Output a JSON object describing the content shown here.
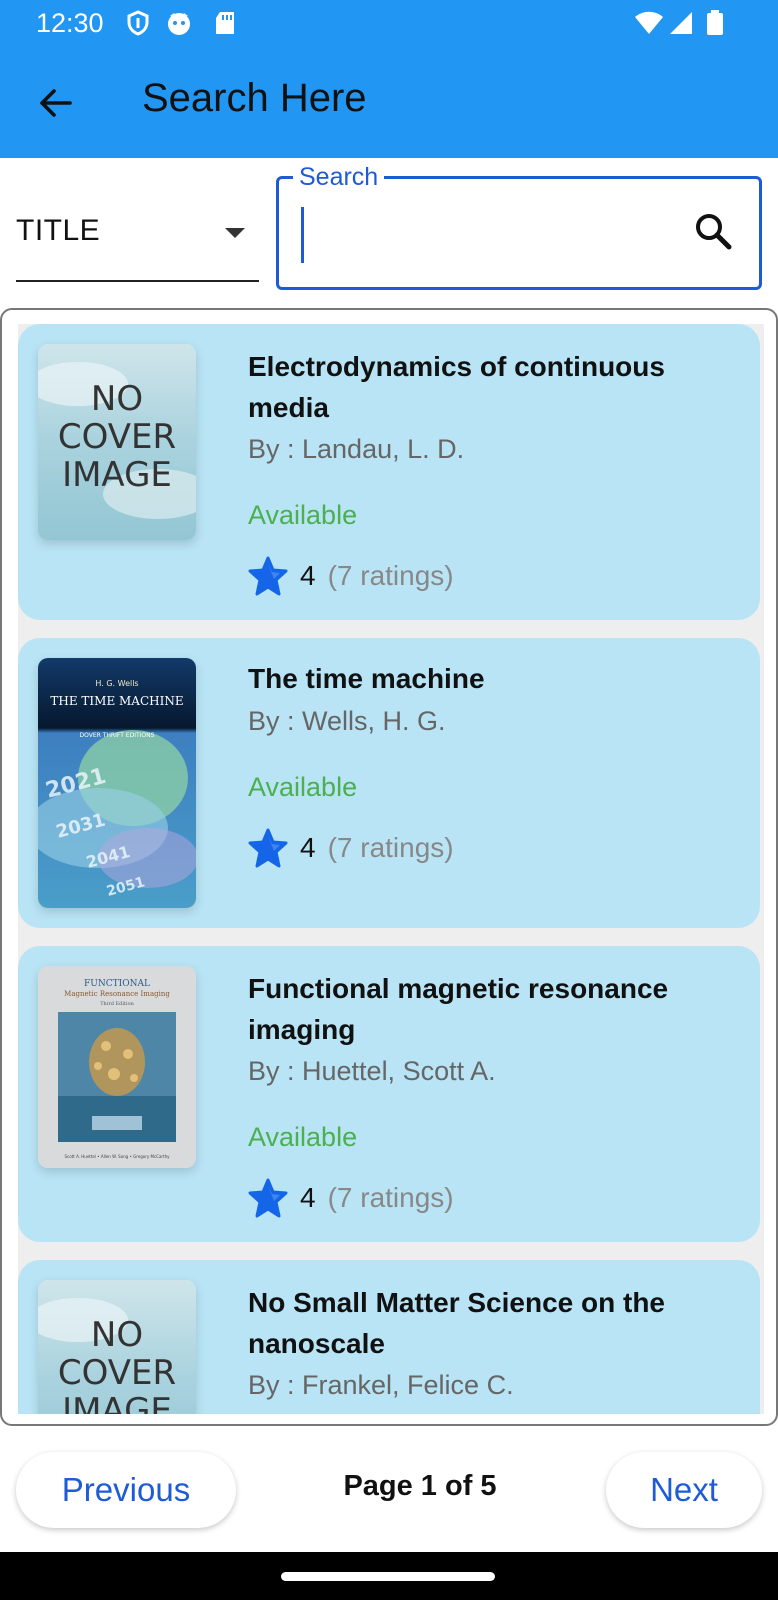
{
  "status_bar": {
    "time": "12:30"
  },
  "app_bar": {
    "title": "Search Here"
  },
  "filter": {
    "selected": "TITLE"
  },
  "search": {
    "label": "Search",
    "value": "",
    "placeholder": ""
  },
  "books": [
    {
      "title": "Electrodynamics of continuous media",
      "author": "By : Landau, L. D.",
      "status": "Available",
      "rating": "4",
      "ratings_count": "(7 ratings)",
      "cover": "no-cover",
      "cover_text": "NO COVER IMAGE"
    },
    {
      "title": "The time machine",
      "author": "By : Wells, H. G.",
      "status": "Available",
      "rating": "4",
      "ratings_count": "(7 ratings)",
      "cover": "time-machine",
      "cover_author": "H. G. Wells",
      "cover_title": "THE TIME MACHINE",
      "cover_series": "DOVER THRIFT EDITIONS"
    },
    {
      "title": "Functional magnetic resonance imaging",
      "author": "By : Huettel, Scott A.",
      "status": "Available",
      "rating": "4",
      "ratings_count": "(7 ratings)",
      "cover": "fmri",
      "cover_title": "FUNCTIONAL",
      "cover_subtitle": "Magnetic Resonance Imaging",
      "cover_edition": "Third Edition",
      "cover_authors": "Scott A. Huettel • Allen W. Song • Gregory McCarthy"
    },
    {
      "title": "No Small Matter Science on the nanoscale",
      "author": "By : Frankel, Felice C.",
      "status": "",
      "rating": "",
      "ratings_count": "",
      "cover": "no-cover",
      "cover_text": "NO COVER IMAGE"
    }
  ],
  "pagination": {
    "previous_label": "Previous",
    "next_label": "Next",
    "page_info": "Page 1 of 5"
  },
  "colors": {
    "primary": "#2196F3",
    "accent": "#1E5BD6",
    "card": "#B8E4F5",
    "available": "#4CAF50",
    "star": "#1565E8"
  }
}
